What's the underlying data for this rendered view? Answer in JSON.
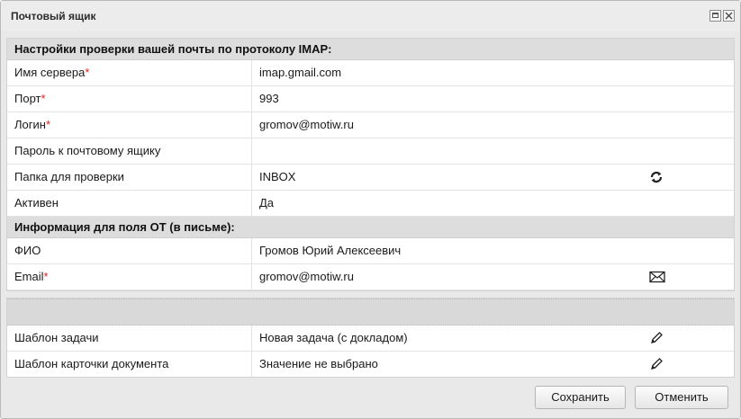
{
  "window": {
    "title": "Почтовый ящик"
  },
  "imap": {
    "header": "Настройки проверки вашей почты по протоколу IMAP:",
    "rows": [
      {
        "label": "Имя сервера",
        "required": "*",
        "value": "imap.gmail.com"
      },
      {
        "label": "Порт",
        "required": "*",
        "value": "993"
      },
      {
        "label": "Логин",
        "required": "*",
        "value": "gromov@motiw.ru"
      },
      {
        "label": "Пароль к почтовому ящику",
        "required": "",
        "value": ""
      },
      {
        "label": "Папка для проверки",
        "required": "",
        "value": "INBOX",
        "icon": "refresh-icon"
      },
      {
        "label": "Активен",
        "required": "",
        "value": "Да"
      }
    ]
  },
  "from": {
    "header": "Информация для поля ОТ (в письме):",
    "rows": [
      {
        "label": "ФИО",
        "required": "",
        "value": "Громов Юрий Алексеевич"
      },
      {
        "label": "Email",
        "required": "*",
        "value": "gromov@motiw.ru",
        "icon": "envelope-icon"
      }
    ]
  },
  "templates": {
    "rows": [
      {
        "label": "Шаблон задачи",
        "value": "Новая задача (с докладом)",
        "icon": "pencil-icon"
      },
      {
        "label": "Шаблон карточки документа",
        "value": "Значение не выбрано",
        "icon": "pencil-icon"
      }
    ]
  },
  "buttons": {
    "save": "Сохранить",
    "cancel": "Отменить"
  },
  "colors": {
    "required_marker": "#e02020",
    "header_bg": "#dddddd"
  }
}
